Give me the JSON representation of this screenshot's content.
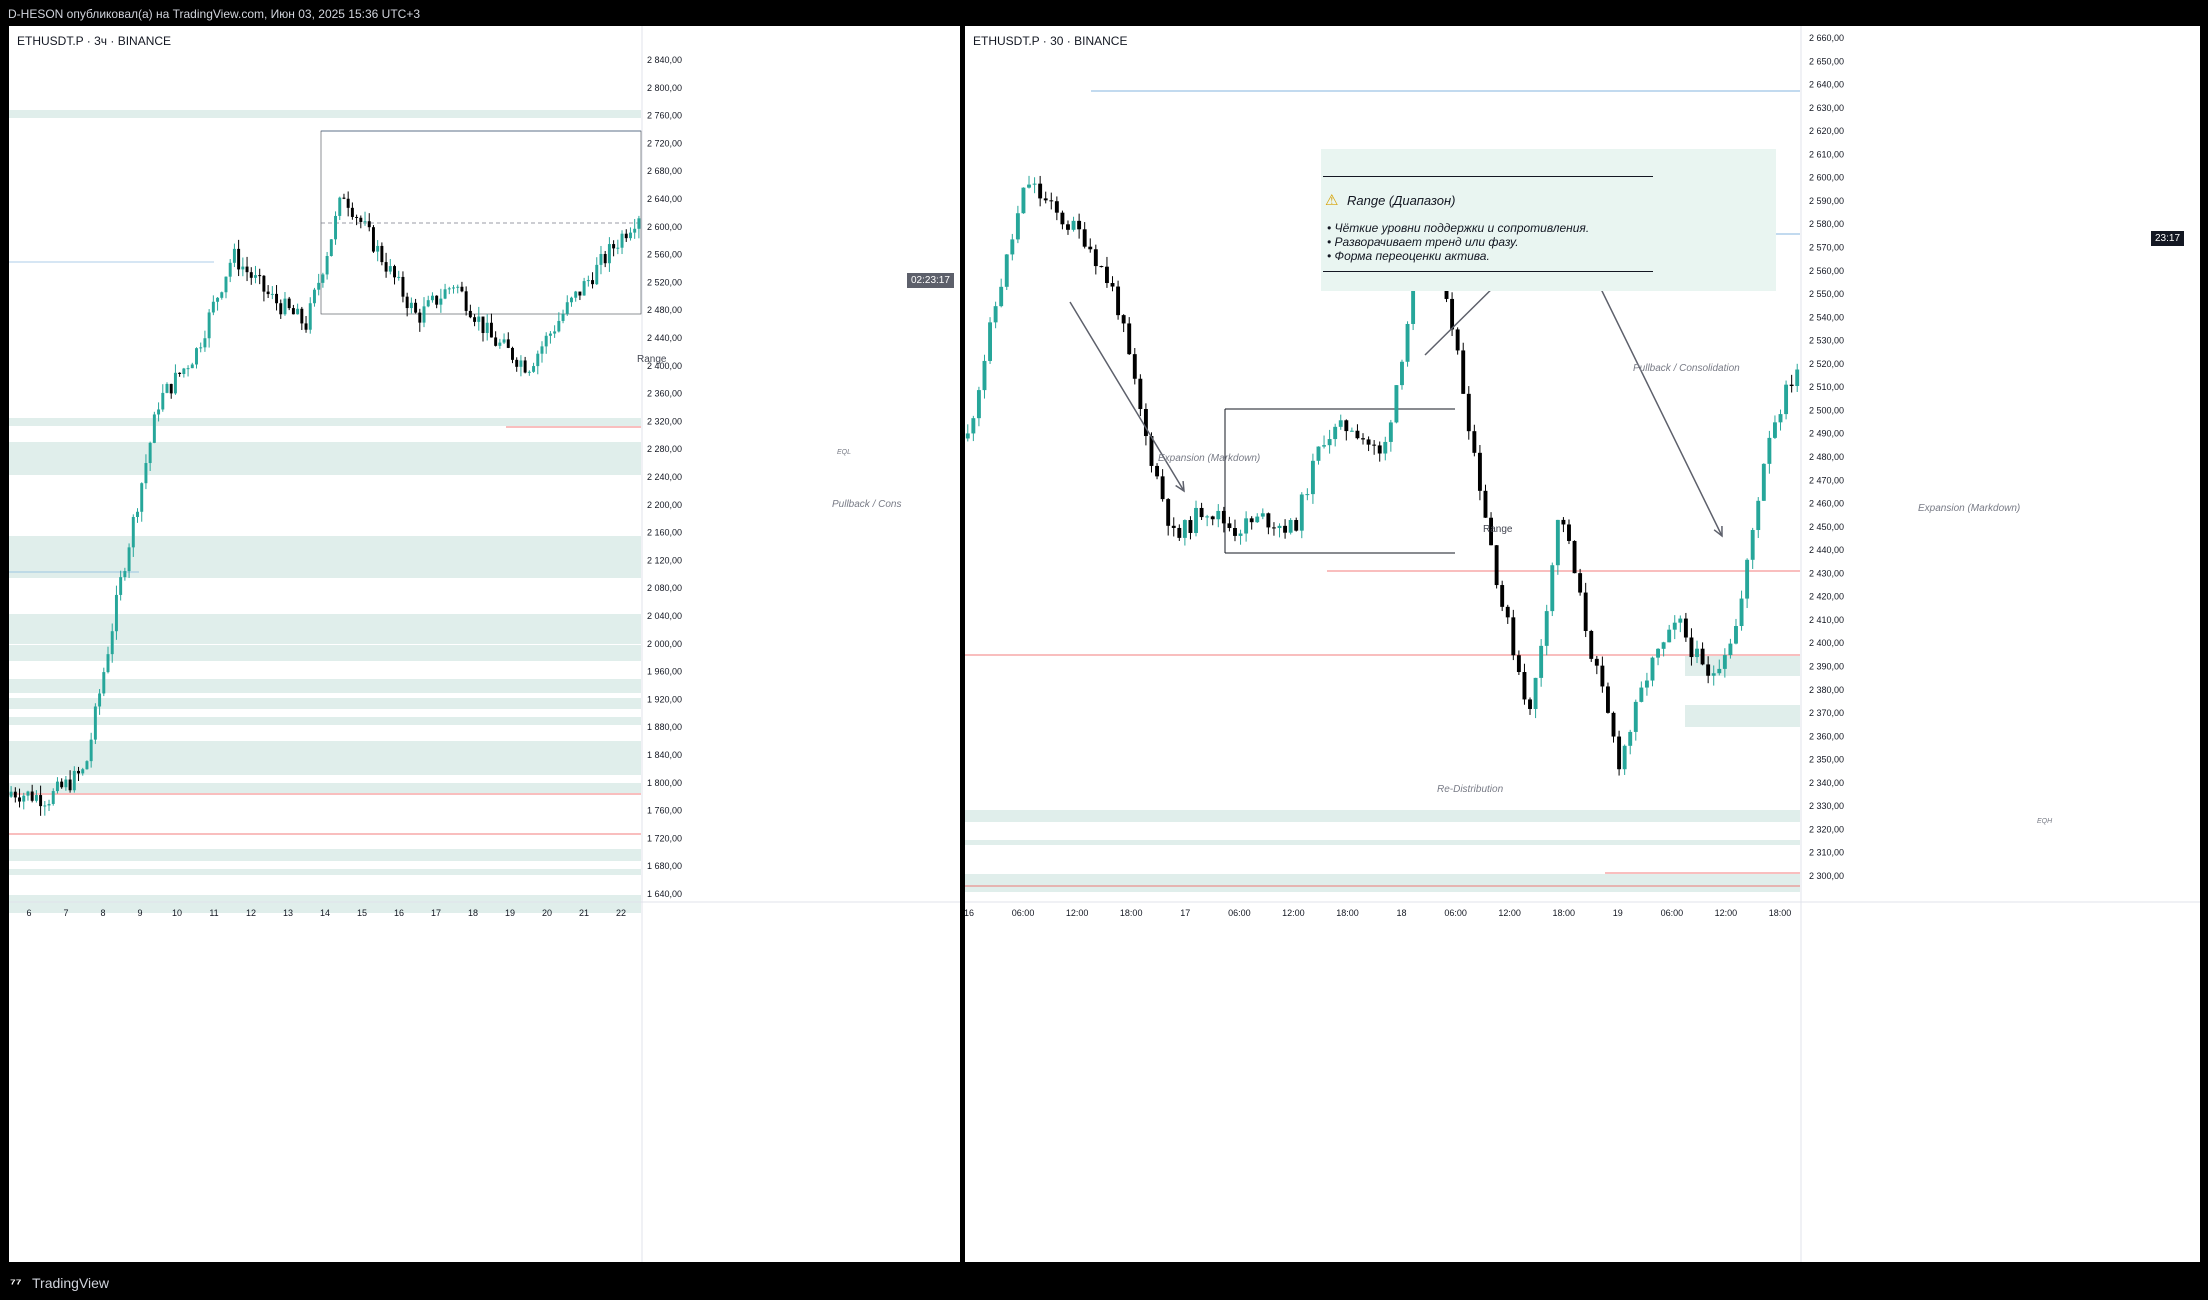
{
  "header": {
    "publish_text": "D-HESON опубликовал(а) на TradingView.com, Июн 03, 2025 15:36 UTC+3"
  },
  "footer": {
    "brand": "TradingView",
    "logo_icon": "tradingview-logo-icon"
  },
  "colors": {
    "up": "#26a69a",
    "down": "#000000",
    "zone": "#cfe5e0",
    "red": "#ef5350",
    "blue": "#5b9bd5"
  },
  "left_chart": {
    "symbol": "ETHUSDT.P · 3ч · BINANCE",
    "price_scale": [
      "2 840,00",
      "2 800,00",
      "2 760,00",
      "2 720,00",
      "2 680,00",
      "2 640,00",
      "2 600,00",
      "2 560,00",
      "2 520,00",
      "2 480,00",
      "2 440,00",
      "2 400,00",
      "2 360,00",
      "2 320,00",
      "2 280,00",
      "2 240,00",
      "2 200,00",
      "2 160,00",
      "2 120,00",
      "2 080,00",
      "2 040,00",
      "2 000,00",
      "1 960,00",
      "1 920,00",
      "1 880,00",
      "1 840,00",
      "1 800,00",
      "1 760,00",
      "1 720,00",
      "1 680,00",
      "1 640,00"
    ],
    "time_scale": [
      "6",
      "7",
      "8",
      "9",
      "10",
      "11",
      "12",
      "13",
      "14",
      "15",
      "16",
      "17",
      "18",
      "19",
      "20",
      "21",
      "22"
    ],
    "countdown": "02:23:17",
    "annotations": {
      "range": "Range",
      "pullback": "Pullback / Cons",
      "eql": "EQL"
    }
  },
  "right_chart": {
    "symbol": "ETHUSDT.P · 30 · BINANCE",
    "price_scale": [
      "2 660,00",
      "2 650,00",
      "2 640,00",
      "2 630,00",
      "2 620,00",
      "2 610,00",
      "2 600,00",
      "2 590,00",
      "2 580,00",
      "2 570,00",
      "2 560,00",
      "2 550,00",
      "2 540,00",
      "2 530,00",
      "2 520,00",
      "2 510,00",
      "2 500,00",
      "2 490,00",
      "2 480,00",
      "2 470,00",
      "2 460,00",
      "2 450,00",
      "2 440,00",
      "2 430,00",
      "2 420,00",
      "2 410,00",
      "2 400,00",
      "2 390,00",
      "2 380,00",
      "2 370,00",
      "2 360,00",
      "2 350,00",
      "2 340,00",
      "2 330,00",
      "2 320,00",
      "2 310,00",
      "2 300,00"
    ],
    "time_scale": [
      "16",
      "06:00",
      "12:00",
      "18:00",
      "17",
      "06:00",
      "12:00",
      "18:00",
      "18",
      "06:00",
      "12:00",
      "18:00",
      "19",
      "06:00",
      "12:00",
      "18:00"
    ],
    "countdown": "23:17",
    "annotations": {
      "expansion1": "Expansion (Markdown)",
      "range": "Range",
      "redistribution": "Re-Distribution",
      "pullback": "Pullback / Consolidation",
      "expansion2": "Expansion (Markdown)",
      "eqh": "EQH"
    },
    "note": {
      "title": "Range (Диапазон)",
      "warning_icon": "warning-icon",
      "bullets": [
        "• Чёткие уровни поддержки и сопротивления.",
        "• Разворачивает тренд или фазу.",
        "• Форма переоценки актива."
      ]
    }
  }
}
